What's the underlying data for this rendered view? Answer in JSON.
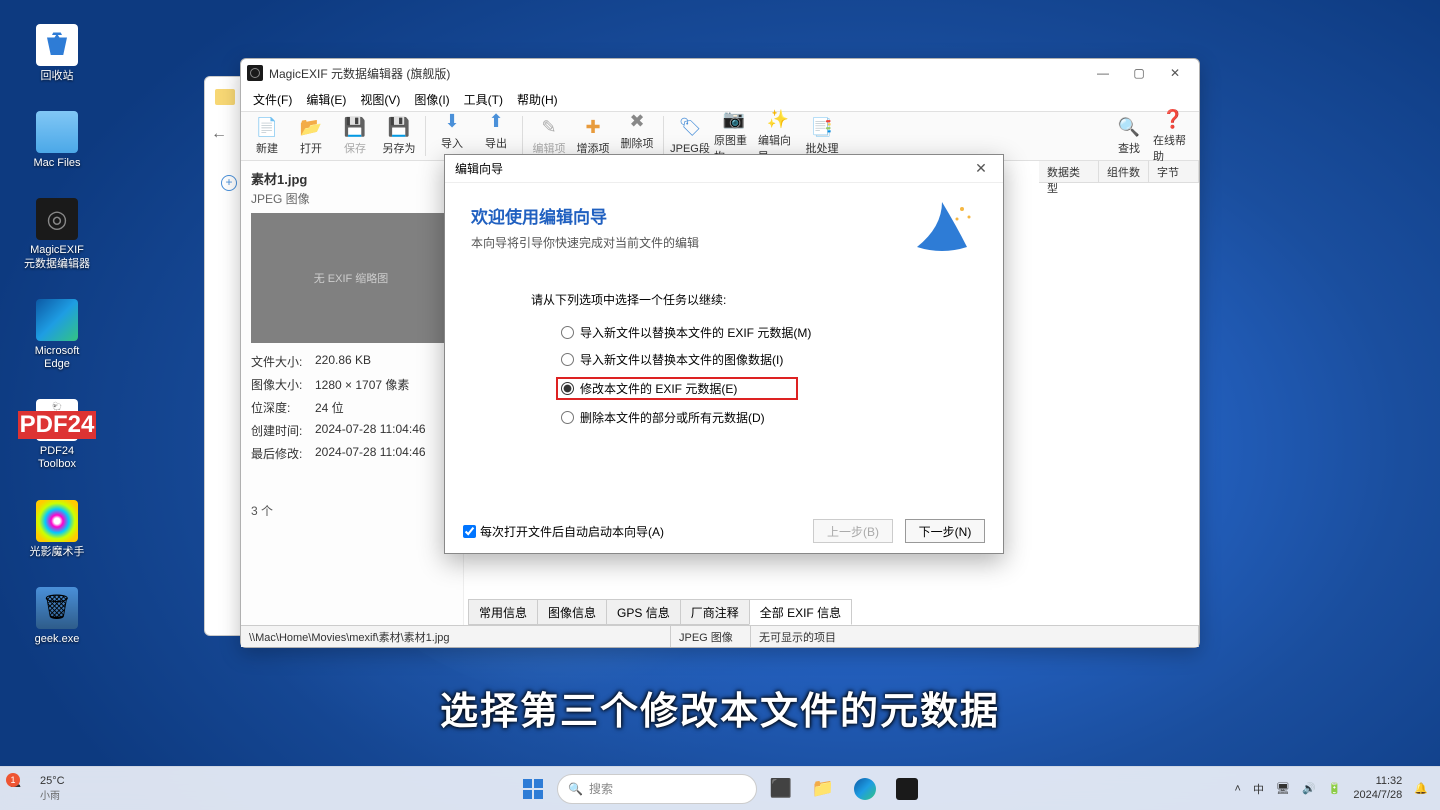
{
  "desktop": {
    "icons": [
      {
        "label": "回收站"
      },
      {
        "label": "Mac Files"
      },
      {
        "label": "MagicEXIF\n元数据编辑器"
      },
      {
        "label": "Microsoft\nEdge"
      },
      {
        "label": "PDF24\nToolbox"
      },
      {
        "label": "光影魔术手"
      },
      {
        "label": "geek.exe"
      }
    ]
  },
  "app": {
    "title": "MagicEXIF 元数据编辑器 (旗舰版)",
    "menu": [
      "文件(F)",
      "编辑(E)",
      "视图(V)",
      "图像(I)",
      "工具(T)",
      "帮助(H)"
    ],
    "toolbar": {
      "new": "新建",
      "open": "打开",
      "save": "保存",
      "saveas": "另存为",
      "import": "导入",
      "export": "导出",
      "editItem": "编辑项",
      "addItem": "增添项",
      "delItem": "删除项",
      "jpeg": "JPEG段",
      "rebuild": "原图重构",
      "wizard": "编辑向导",
      "batch": "批处理",
      "find": "查找",
      "help": "在线帮助"
    },
    "table_headers": [
      "数据类型",
      "组件数",
      "字节"
    ]
  },
  "sidebar": {
    "filename": "素材1.jpg",
    "filetype": "JPEG 图像",
    "thumb_text": "无 EXIF 缩略图",
    "labels": {
      "filesize": "文件大小:",
      "imagesize": "图像大小:",
      "bitdepth": "位深度:",
      "created": "创建时间:",
      "modified": "最后修改:"
    },
    "filesize": "220.86 KB",
    "imagesize": "1280 × 1707 像素",
    "bitdepth": "24 位",
    "created": "2024-07-28 11:04:46",
    "modified": "2024-07-28 11:04:46",
    "count": "3 个"
  },
  "tabs": [
    "常用信息",
    "图像信息",
    "GPS 信息",
    "厂商注释",
    "全部 EXIF 信息"
  ],
  "statusbar": {
    "path": "\\\\Mac\\Home\\Movies\\mexif\\素材\\素材1.jpg",
    "type": "JPEG 图像",
    "info": "无可显示的项目"
  },
  "wizard": {
    "title": "编辑向导",
    "welcome": "欢迎使用编辑向导",
    "sub": "本向导将引导你快速完成对当前文件的编辑",
    "prompt": "请从下列选项中选择一个任务以继续:",
    "options": [
      "导入新文件以替换本文件的 EXIF 元数据(M)",
      "导入新文件以替换本文件的图像数据(I)",
      "修改本文件的 EXIF 元数据(E)",
      "删除本文件的部分或所有元数据(D)"
    ],
    "autolaunch": "每次打开文件后自动启动本向导(A)",
    "prev": "上一步(B)",
    "next": "下一步(N)"
  },
  "caption": "选择第三个修改本文件的元数据",
  "taskbar": {
    "temp": "25°C",
    "cond": "小雨",
    "search_placeholder": "搜索",
    "ime": "中",
    "time": "11:32",
    "date": "2024/7/28"
  }
}
